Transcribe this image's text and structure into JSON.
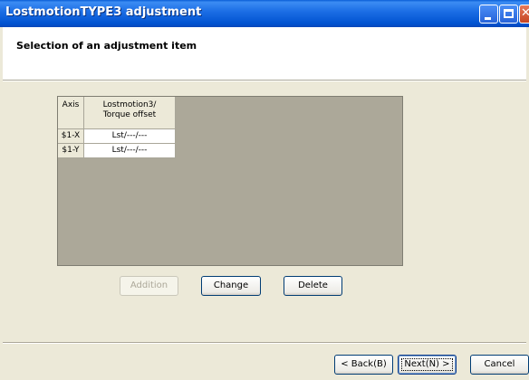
{
  "window": {
    "title": "LostmotionTYPE3 adjustment"
  },
  "header": {
    "title": "Selection of an adjustment item"
  },
  "table": {
    "columns": [
      "Axis",
      "Lostmotion3/\nTorque offset"
    ],
    "rows": [
      {
        "axis": "$1-X",
        "value": "Lst/---/---"
      },
      {
        "axis": "$1-Y",
        "value": "Lst/---/---"
      }
    ]
  },
  "actions": {
    "addition_label": "Addition",
    "change_label": "Change",
    "delete_label": "Delete"
  },
  "footer": {
    "back_label": "< Back(B)",
    "next_label": "Next(N) >",
    "cancel_label": "Cancel"
  },
  "colors": {
    "title_bar": "#0052d0",
    "dialog_bg": "#ece9d8",
    "grid_bg": "#aca899"
  },
  "icons": [
    "minimize-icon",
    "maximize-icon",
    "close-icon"
  ]
}
